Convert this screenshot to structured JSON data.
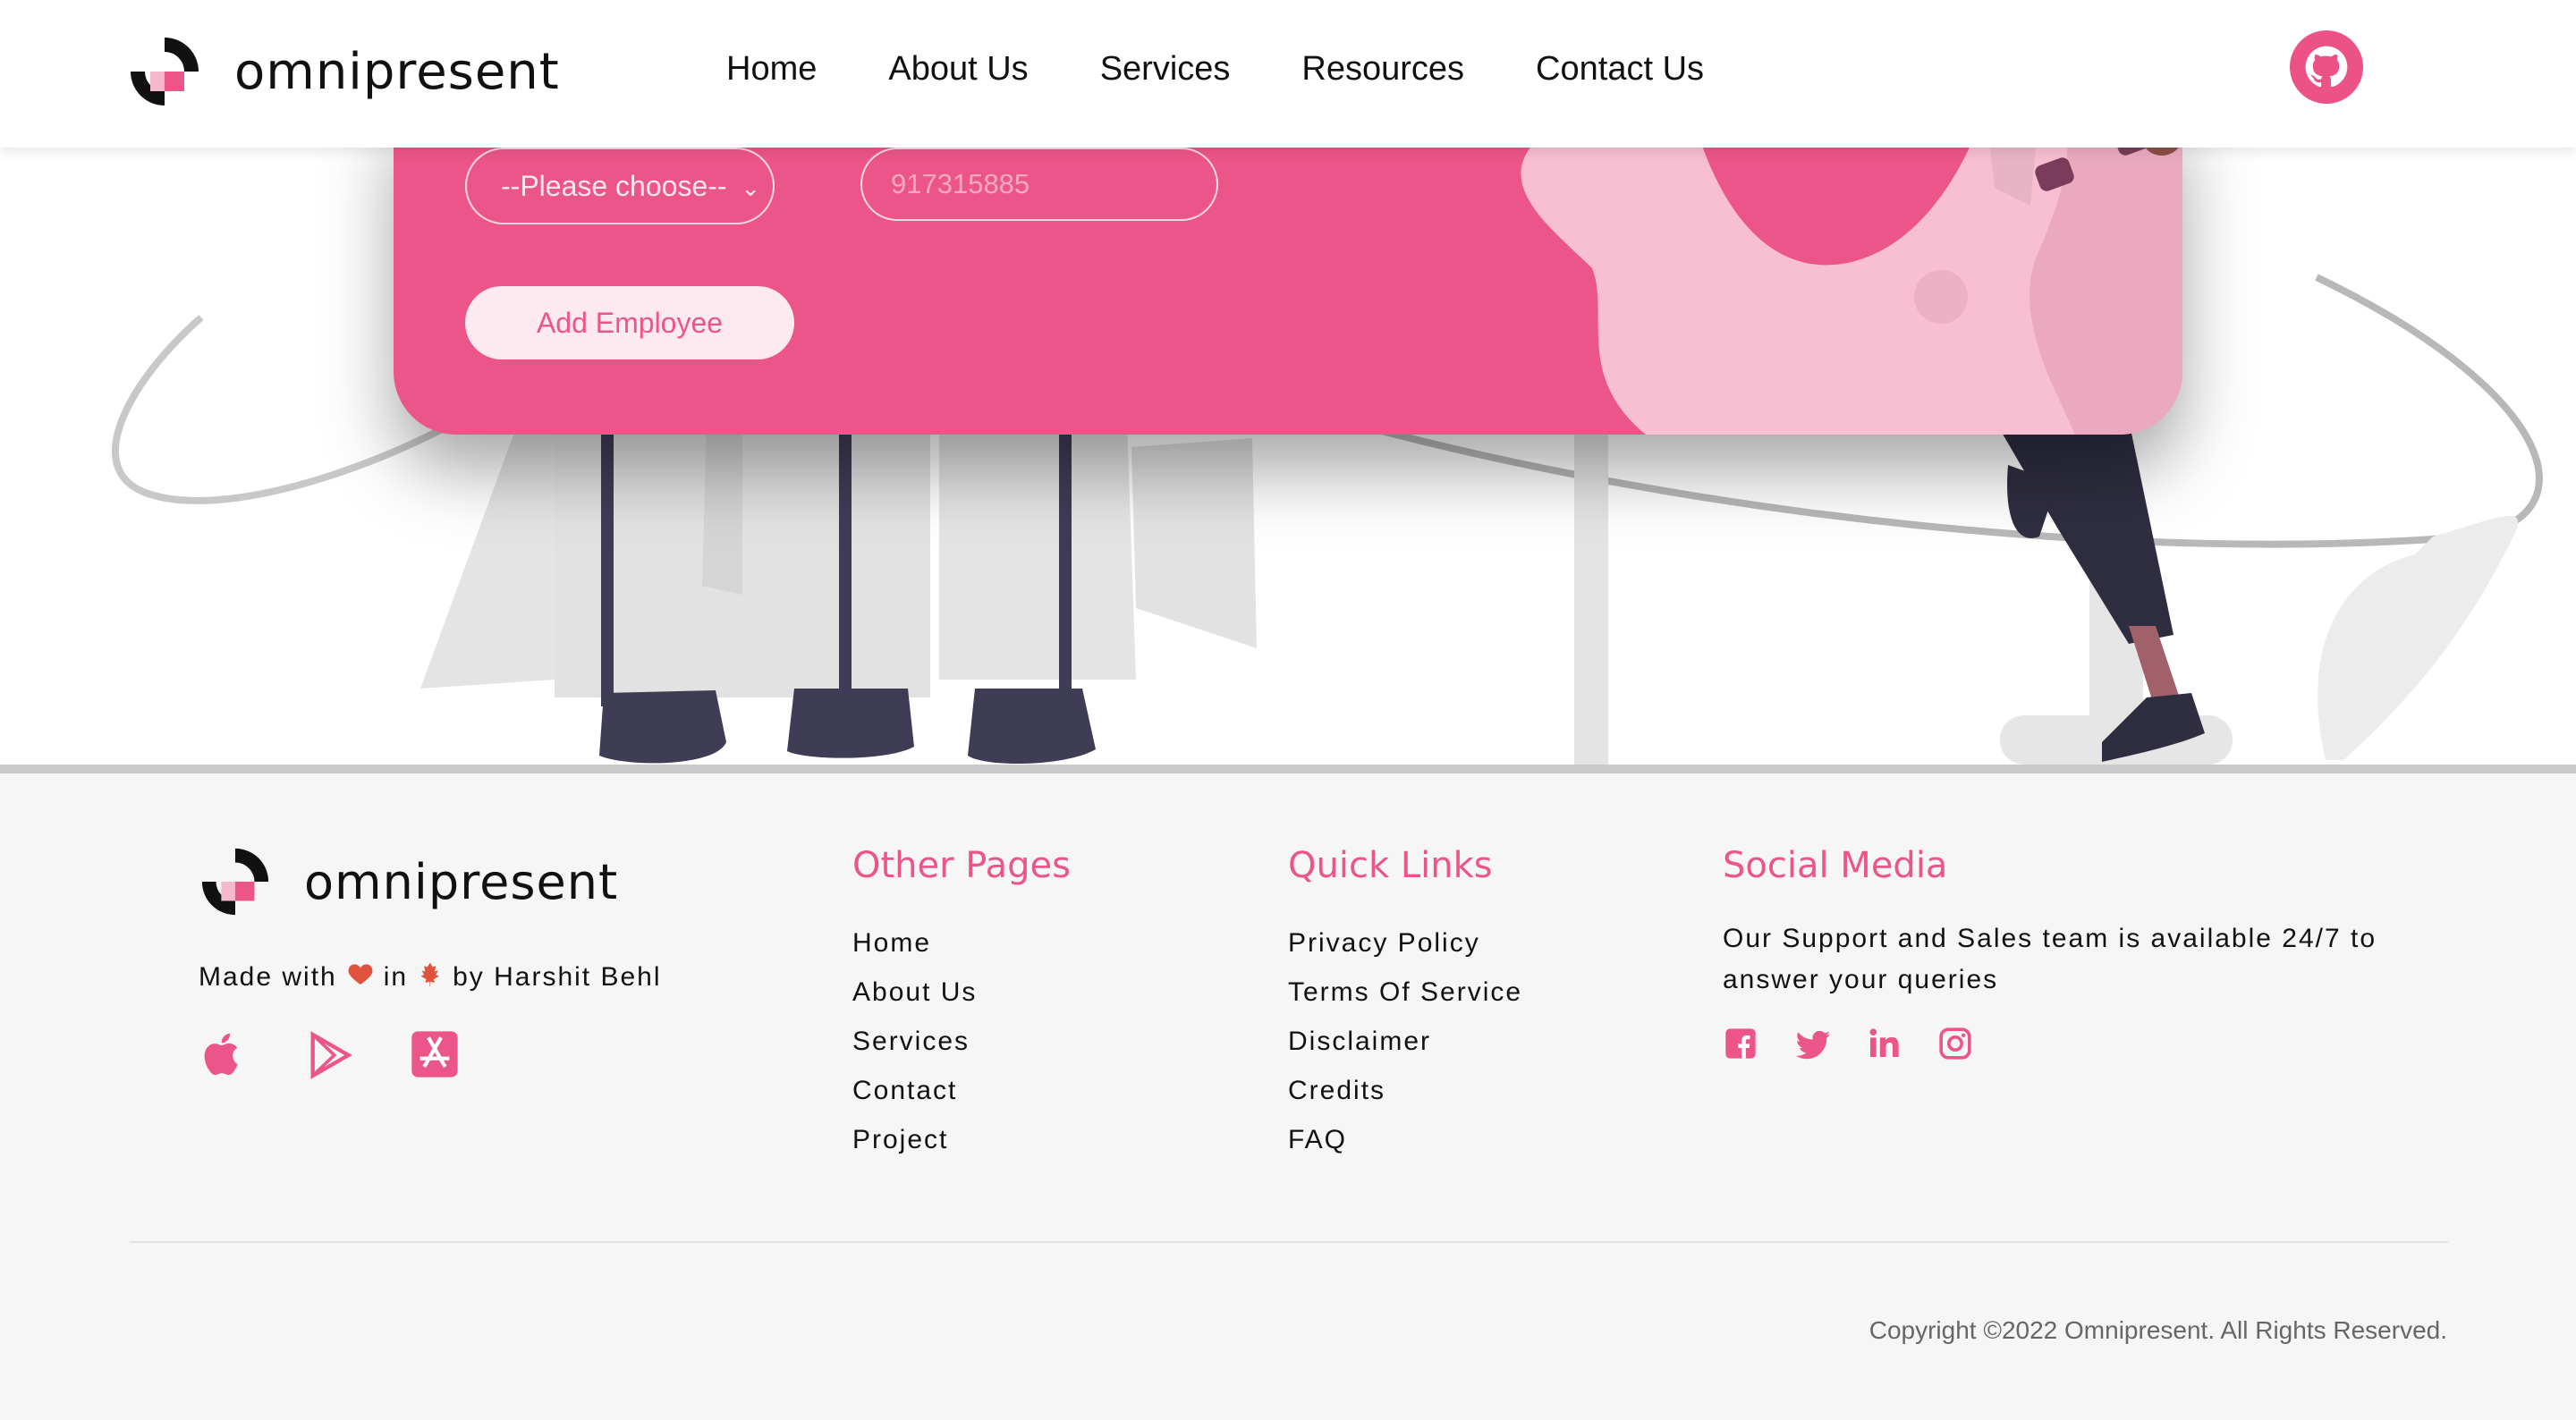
{
  "header": {
    "brand": "omnipresent",
    "nav": [
      "Home",
      "About Us",
      "Services",
      "Resources",
      "Contact Us"
    ],
    "github_icon": "github-icon"
  },
  "form": {
    "department_select": "--Please choose--",
    "phone_placeholder": "917315885",
    "add_button": "Add Employee"
  },
  "footer": {
    "brand": "omnipresent",
    "made_with_prefix": "Made with",
    "made_with_in": "in",
    "made_with_by": "by Harshit Behl",
    "store_icons": [
      "apple-icon",
      "google-play-icon",
      "app-store-icon"
    ],
    "other_pages": {
      "title": "Other Pages",
      "links": [
        "Home",
        "About Us",
        "Services",
        "Contact",
        "Project"
      ]
    },
    "quick_links": {
      "title": "Quick Links",
      "links": [
        "Privacy Policy",
        "Terms Of Service",
        "Disclaimer",
        "Credits",
        "FAQ"
      ]
    },
    "social_media": {
      "title": "Social Media",
      "text": "Our Support and Sales team is available 24/7 to answer your queries",
      "icons": [
        "facebook-icon",
        "twitter-icon",
        "linkedin-icon",
        "instagram-icon"
      ]
    },
    "copyright": "Copyright ©2022 Omnipresent. All Rights Reserved."
  },
  "colors": {
    "accent": "#ec5589",
    "card_pink": "#ec5589",
    "footer_bg": "#f6f6f6"
  }
}
